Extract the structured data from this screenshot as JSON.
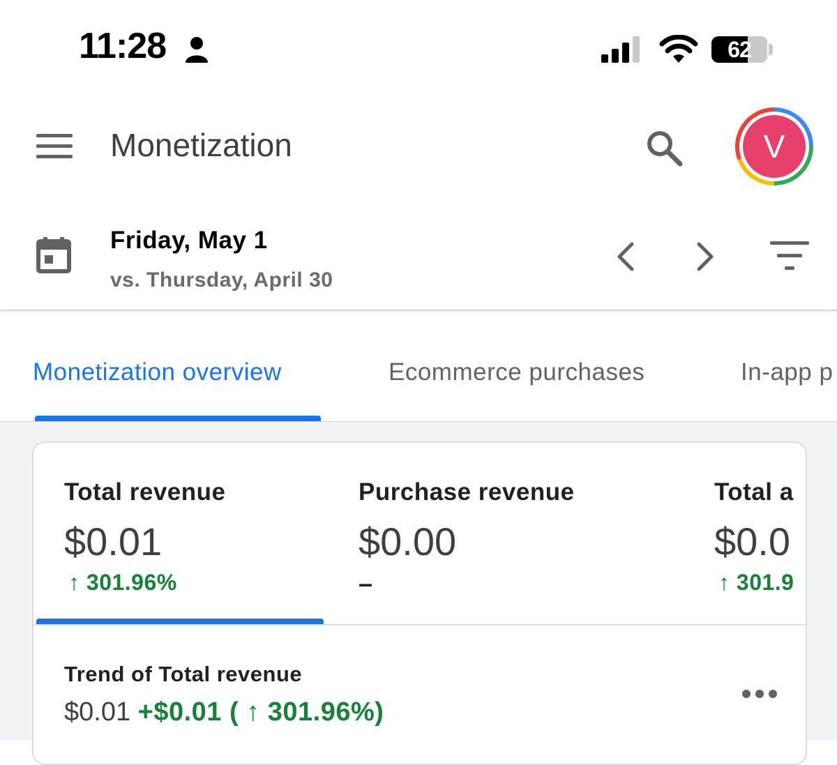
{
  "status_bar": {
    "time": "11:28",
    "battery": "62"
  },
  "app_bar": {
    "title": "Monetization",
    "avatar_letter": "V"
  },
  "date_range": {
    "primary": "Friday, May 1",
    "comparison": "vs. Thursday, April 30"
  },
  "tabs": [
    {
      "label": "Monetization overview",
      "active": true
    },
    {
      "label": "Ecommerce purchases",
      "active": false
    },
    {
      "label": "In-app p",
      "active": false
    }
  ],
  "metrics": [
    {
      "label": "Total revenue",
      "value": "$0.01",
      "change": "↑ 301.96%",
      "selected": true
    },
    {
      "label": "Purchase revenue",
      "value": "$0.00",
      "change": "–",
      "selected": false
    },
    {
      "label": "Total a",
      "value": "$0.0",
      "change": "↑ 301.9",
      "selected": false
    }
  ],
  "trend": {
    "title": "Trend of Total revenue",
    "value": "$0.01",
    "delta": "+$0.01 ( ↑ 301.96%)"
  },
  "colors": {
    "accent": "#1a73e8",
    "positive": "#188038",
    "avatar": "#e7406c"
  }
}
